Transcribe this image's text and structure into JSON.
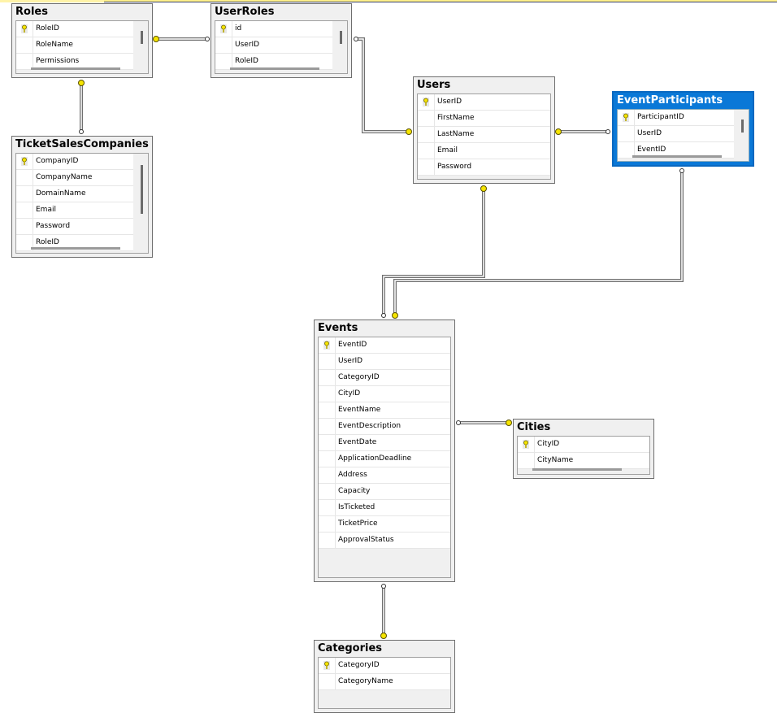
{
  "tables": [
    {
      "name": "Roles",
      "columns": [
        "RoleID",
        "RoleName",
        "Permissions"
      ],
      "pk": "RoleID"
    },
    {
      "name": "UserRoles",
      "columns": [
        "id",
        "UserID",
        "RoleID"
      ],
      "pk": "id"
    },
    {
      "name": "TicketSalesCompanies",
      "columns": [
        "CompanyID",
        "CompanyName",
        "DomainName",
        "Email",
        "Password",
        "RoleID"
      ],
      "pk": "CompanyID"
    },
    {
      "name": "Users",
      "columns": [
        "UserID",
        "FirstName",
        "LastName",
        "Email",
        "Password"
      ],
      "pk": "UserID"
    },
    {
      "name": "EventParticipants",
      "columns": [
        "ParticipantID",
        "UserID",
        "EventID"
      ],
      "pk": "ParticipantID",
      "selected": true
    },
    {
      "name": "Events",
      "columns": [
        "EventID",
        "UserID",
        "CategoryID",
        "CityID",
        "EventName",
        "EventDescription",
        "EventDate",
        "ApplicationDeadline",
        "Address",
        "Capacity",
        "IsTicketed",
        "TicketPrice",
        "ApprovalStatus"
      ],
      "pk": "EventID"
    },
    {
      "name": "Cities",
      "columns": [
        "CityID",
        "CityName"
      ],
      "pk": "CityID"
    },
    {
      "name": "Categories",
      "columns": [
        "CategoryID",
        "CategoryName"
      ],
      "pk": "CategoryID"
    }
  ],
  "relationships": [
    {
      "from": "Roles",
      "to": "UserRoles"
    },
    {
      "from": "Roles",
      "to": "TicketSalesCompanies"
    },
    {
      "from": "Users",
      "to": "UserRoles"
    },
    {
      "from": "Users",
      "to": "EventParticipants"
    },
    {
      "from": "Users",
      "to": "Events"
    },
    {
      "from": "Events",
      "to": "EventParticipants"
    },
    {
      "from": "Cities",
      "to": "Events"
    },
    {
      "from": "Categories",
      "to": "Events"
    }
  ],
  "colors": {
    "selected": "#0a78d7",
    "key": "#f5e400",
    "line": "#707070"
  }
}
